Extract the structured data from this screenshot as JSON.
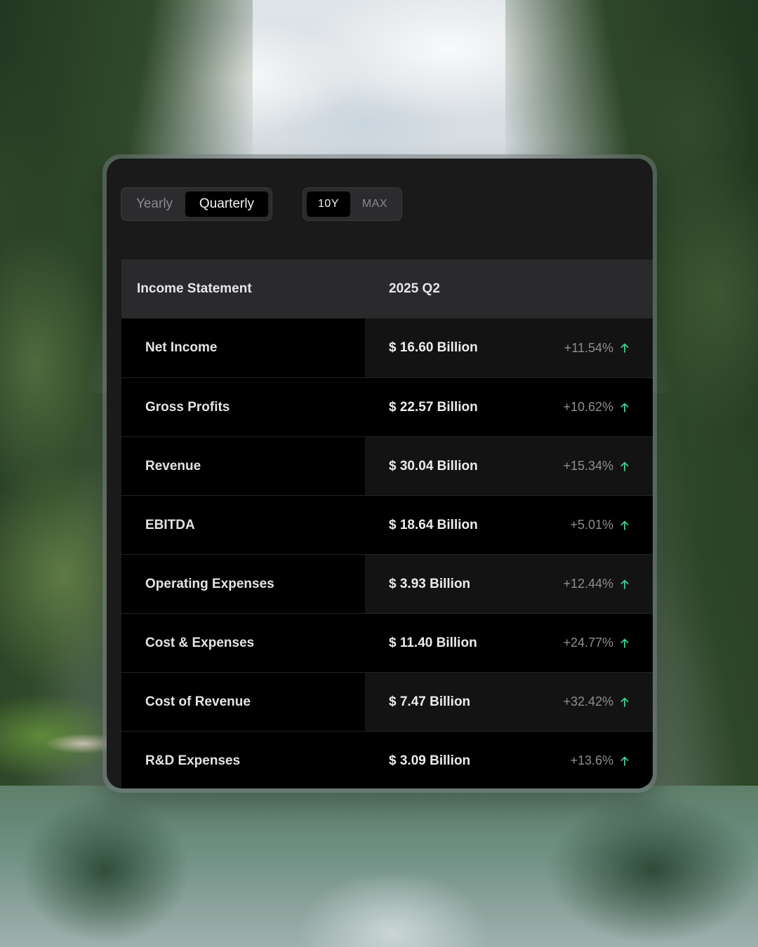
{
  "period_toggle": {
    "options": [
      "Yearly",
      "Quarterly"
    ],
    "selected": "Quarterly"
  },
  "range_toggle": {
    "options": [
      "10Y",
      "MAX"
    ],
    "selected": "10Y"
  },
  "table": {
    "header": {
      "label": "Income Statement",
      "period": "2025 Q2"
    },
    "rows": [
      {
        "label": "Net Income",
        "value": "$ 16.60 Billion",
        "change": "+11.54%",
        "trend_icon": "arrow-up-icon"
      },
      {
        "label": "Gross Profits",
        "value": "$ 22.57 Billion",
        "change": "+10.62%",
        "trend_icon": "arrow-up-icon"
      },
      {
        "label": "Revenue",
        "value": "$ 30.04 Billion",
        "change": "+15.34%",
        "trend_icon": "arrow-up-icon"
      },
      {
        "label": "EBITDA",
        "value": "$ 18.64 Billion",
        "change": "+5.01%",
        "trend_icon": "arrow-up-icon"
      },
      {
        "label": "Operating Expenses",
        "value": "$ 3.93 Billion",
        "change": "+12.44%",
        "trend_icon": "arrow-up-icon"
      },
      {
        "label": "Cost & Expenses",
        "value": "$ 11.40 Billion",
        "change": "+24.77%",
        "trend_icon": "arrow-up-icon"
      },
      {
        "label": "Cost of Revenue",
        "value": "$ 7.47 Billion",
        "change": "+32.42%",
        "trend_icon": "arrow-up-icon"
      },
      {
        "label": "R&D Expenses",
        "value": "$ 3.09 Billion",
        "change": "+13.6%",
        "trend_icon": "arrow-up-icon"
      }
    ]
  },
  "colors": {
    "card_background": "#1a1a1b",
    "header_background": "#2a2a2c",
    "positive_arrow": "#3ecf8e"
  }
}
